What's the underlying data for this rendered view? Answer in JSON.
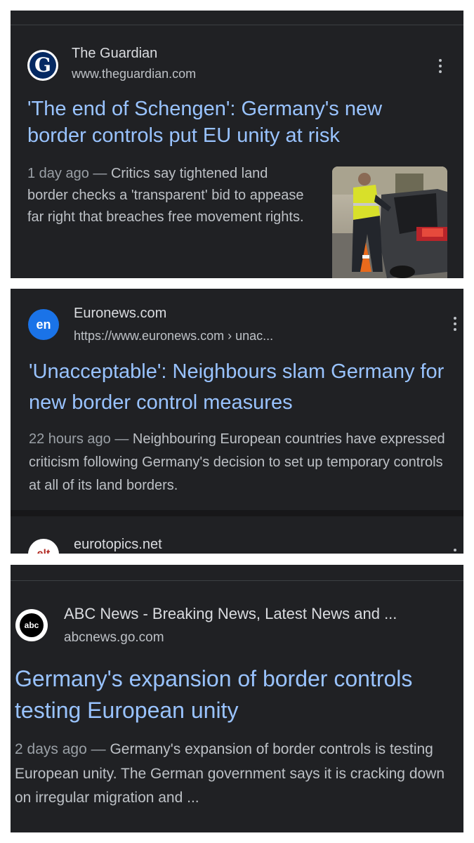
{
  "results": [
    {
      "site_name": "The Guardian",
      "url": "www.theguardian.com",
      "favicon_icon": "guardian-g-icon",
      "favicon_letter": "G",
      "title": "'The end of Schengen': Germany's new border controls put EU unity at risk",
      "date": "1 day ago —",
      "snippet": "Critics say tightened land border checks a 'transparent' bid to appease far right that breaches free movement rights.",
      "has_thumbnail": true,
      "thumbnail_description": "police officer checking car at border"
    },
    {
      "site_name": "Euronews.com",
      "url": "https://www.euronews.com › unac...",
      "favicon_icon": "euronews-icon",
      "favicon_letter": "en",
      "title": "'Unacceptable': Neighbours slam Germany for new border control measures",
      "date": "22 hours ago —",
      "snippet": "Neighbouring European countries have expressed criticism following Germany's decision to set up temporary controls at all of its land borders."
    },
    {
      "site_name": "eurotopics.net",
      "favicon_icon": "eurotopics-icon",
      "favicon_letter": "e|t"
    },
    {
      "site_name": "ABC News - Breaking News, Latest News and ...",
      "url": "abcnews.go.com",
      "favicon_icon": "abc-news-icon",
      "favicon_letter": "abc",
      "title": "Germany's expansion of border controls testing European unity",
      "date": "2 days ago —",
      "snippet": "Germany's expansion of border controls is testing European unity. The German government says it is cracking down on irregular migration and ..."
    }
  ],
  "colors": {
    "panel_bg": "#202124",
    "title_link": "#99c3ff",
    "snippet_text": "#bdc1c6",
    "date_text": "#9aa0a6",
    "guardian_blue": "#052962",
    "euronews_blue": "#1a73e8"
  }
}
